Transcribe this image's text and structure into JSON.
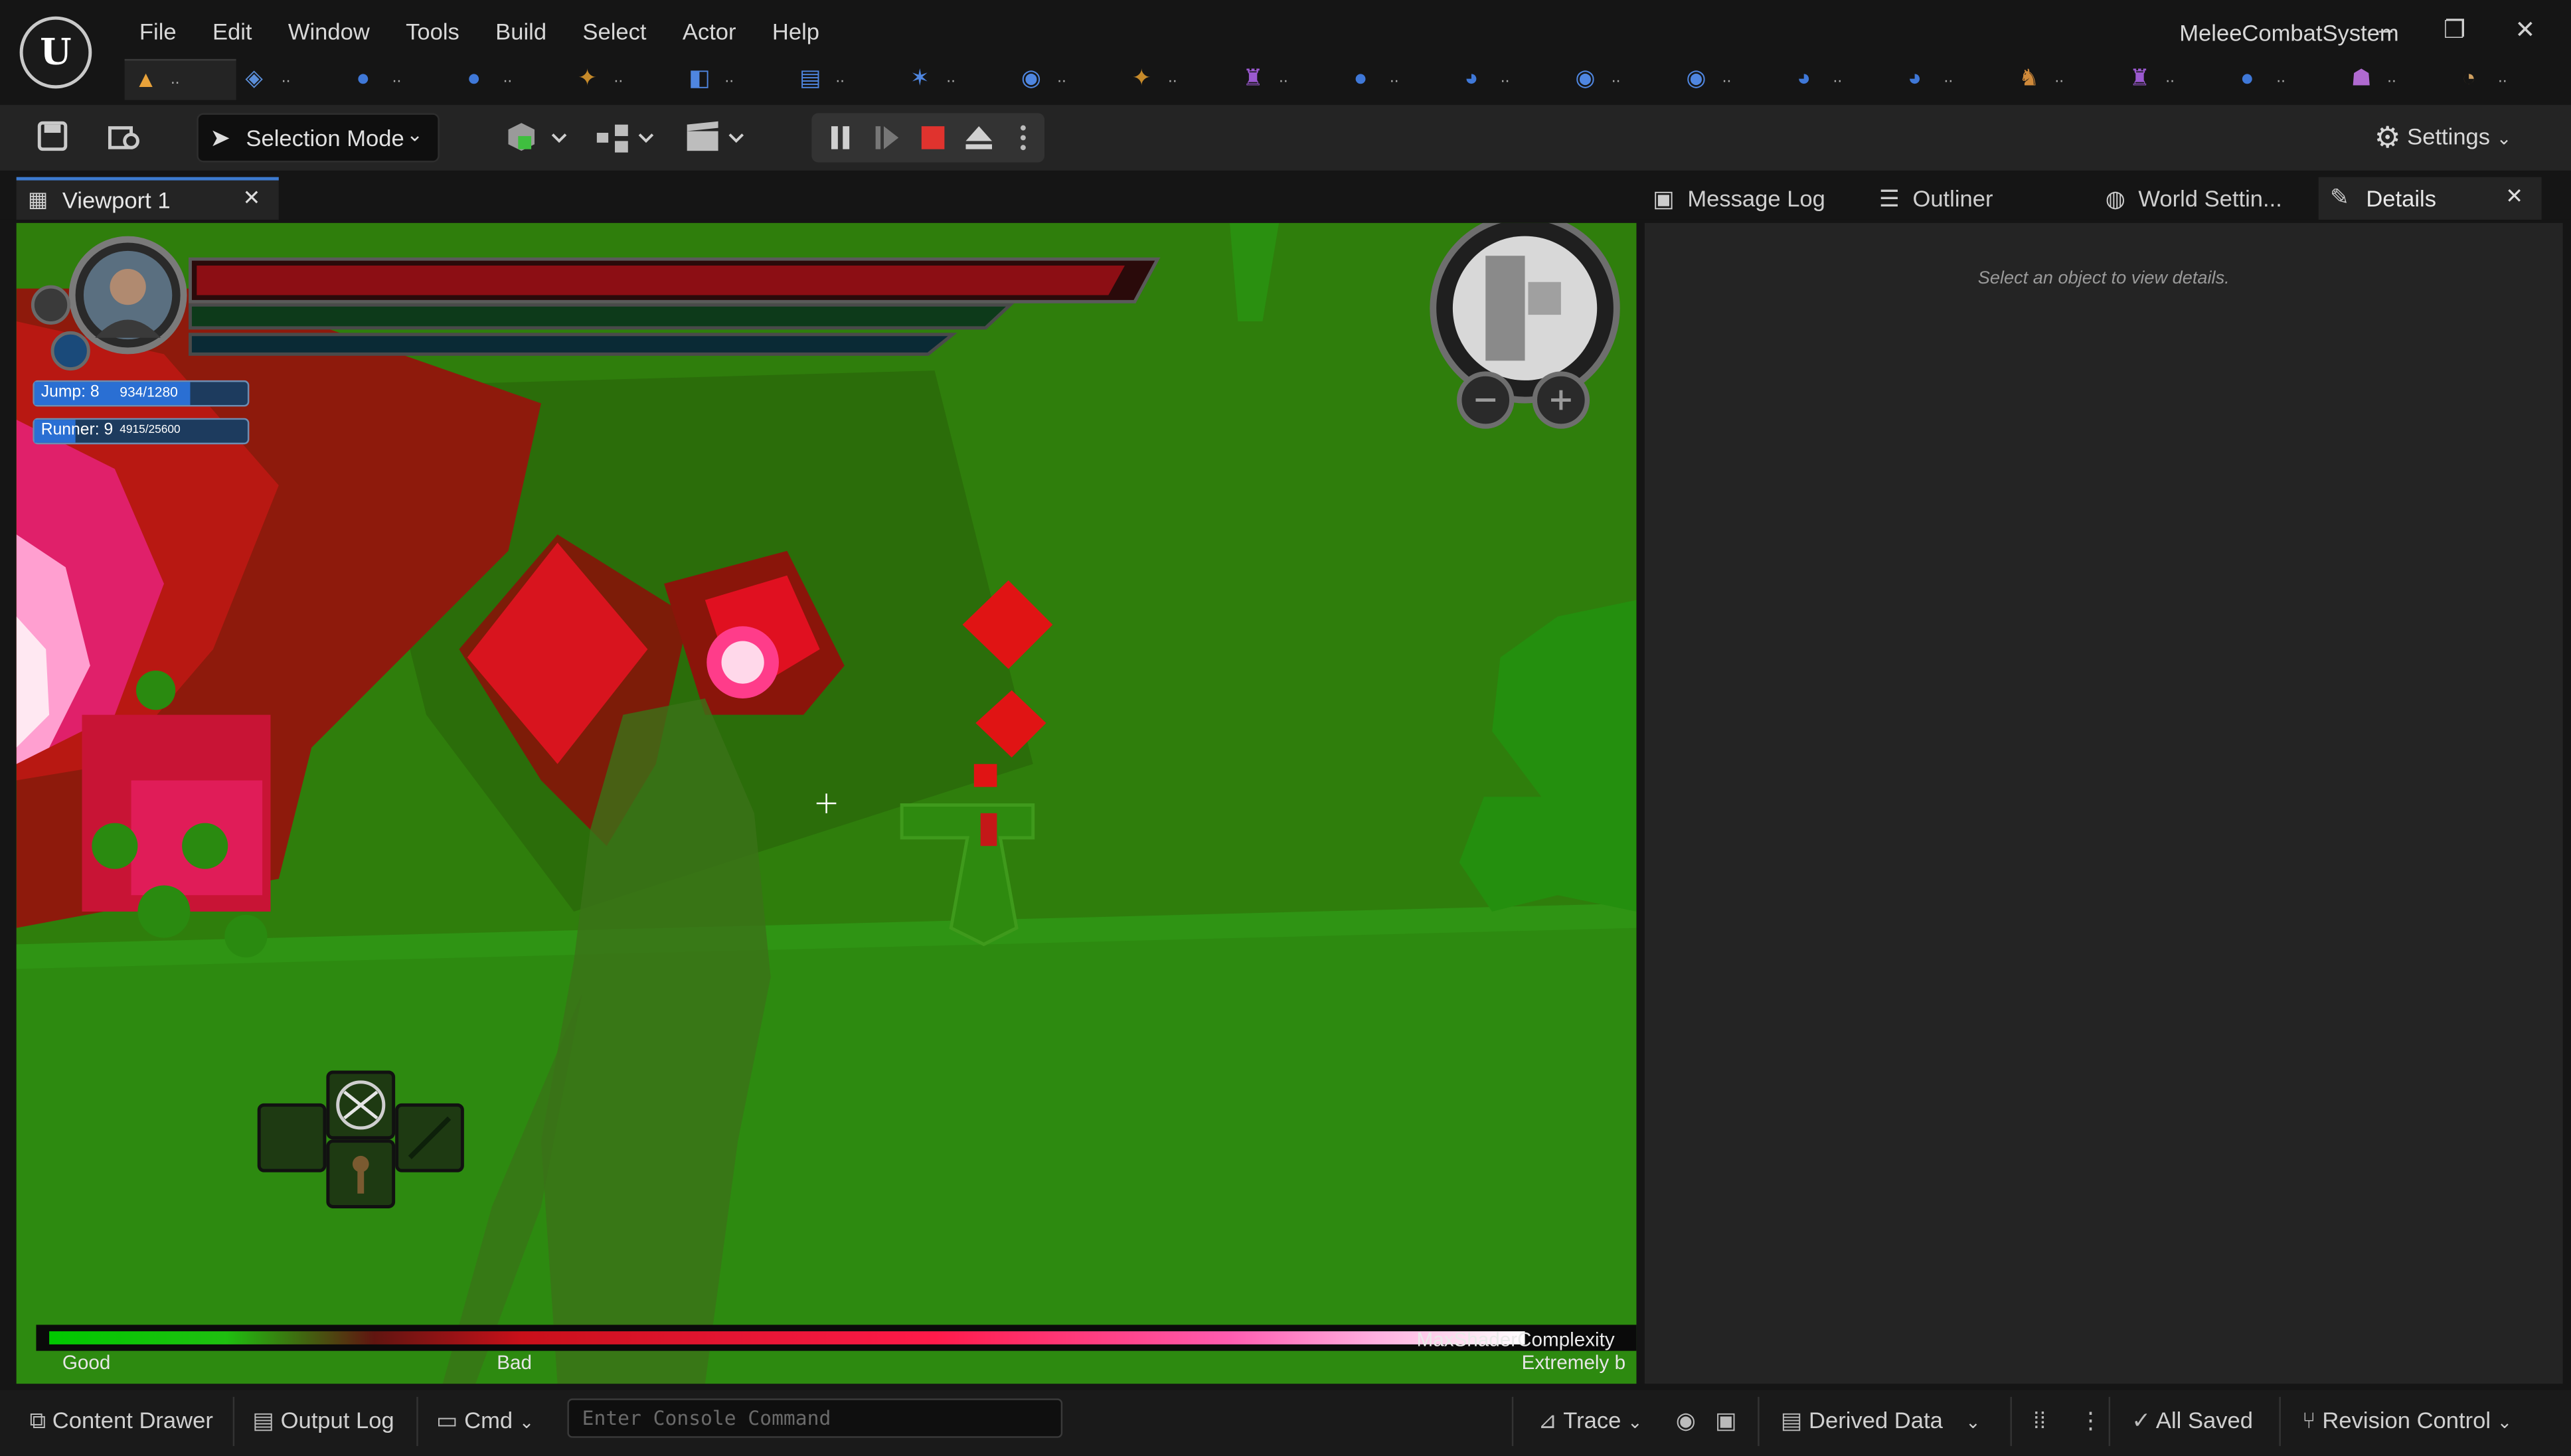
{
  "app": {
    "project_name": "MeleeCombatSystem",
    "logo_glyph": "U",
    "window_controls": {
      "minimize": "–",
      "restore": "❐",
      "close": "✕"
    }
  },
  "menu": [
    "File",
    "Edit",
    "Window",
    "Tools",
    "Build",
    "Select",
    "Actor",
    "Help"
  ],
  "asset_tabs": [
    {
      "icon": "level-icon",
      "glyph": "▲",
      "color": "#e8a23a",
      "label": ".."
    },
    {
      "icon": "blueprint-icon",
      "glyph": "◈",
      "color": "#5b8ed8",
      "label": ".."
    },
    {
      "icon": "skeleton-icon",
      "glyph": "●",
      "color": "#3f78d8",
      "label": ".."
    },
    {
      "icon": "skeleton-icon",
      "glyph": "●",
      "color": "#3f78d8",
      "label": ".."
    },
    {
      "icon": "animation-icon",
      "glyph": "✦",
      "color": "#c68a2a",
      "label": ".."
    },
    {
      "icon": "blueprint-class-icon",
      "glyph": "◧",
      "color": "#4f86e0",
      "label": ".."
    },
    {
      "icon": "blendspace-icon",
      "glyph": "▤",
      "color": "#4f86e0",
      "label": ".."
    },
    {
      "icon": "control-rig-icon",
      "glyph": "✶",
      "color": "#4f86e0",
      "label": ".."
    },
    {
      "icon": "physics-asset-icon",
      "glyph": "◉",
      "color": "#4f86e0",
      "label": ".."
    },
    {
      "icon": "animation-icon",
      "glyph": "✦",
      "color": "#c68a2a",
      "label": ".."
    },
    {
      "icon": "montage-icon",
      "glyph": "♜",
      "color": "#9b59d0",
      "label": ".."
    },
    {
      "icon": "skeleton-icon",
      "glyph": "●",
      "color": "#3f78d8",
      "label": ".."
    },
    {
      "icon": "mesh-icon",
      "glyph": "◕",
      "color": "#3f78d8",
      "label": ".."
    },
    {
      "icon": "physics-asset-icon",
      "glyph": "◉",
      "color": "#4f86e0",
      "label": ".."
    },
    {
      "icon": "physics-asset-icon",
      "glyph": "◉",
      "color": "#4f86e0",
      "label": ".."
    },
    {
      "icon": "mesh-icon",
      "glyph": "◕",
      "color": "#3f78d8",
      "label": ".."
    },
    {
      "icon": "mesh-icon",
      "glyph": "◕",
      "color": "#3f78d8",
      "label": ".."
    },
    {
      "icon": "character-icon",
      "glyph": "♞",
      "color": "#d08a3a",
      "label": ".."
    },
    {
      "icon": "montage-icon",
      "glyph": "♜",
      "color": "#9b59d0",
      "label": ".."
    },
    {
      "icon": "skeleton-icon",
      "glyph": "●",
      "color": "#3f78d8",
      "label": ".."
    },
    {
      "icon": "material-icon",
      "glyph": "☗",
      "color": "#b06ad0",
      "label": ".."
    },
    {
      "icon": "texture-icon",
      "glyph": "◔",
      "color": "#d0a060",
      "label": ".."
    }
  ],
  "toolbar": {
    "selection_mode_label": "Selection Mode",
    "settings_label": "Settings"
  },
  "panel_tabs": {
    "viewport": "Viewport 1",
    "message_log": "Message Log",
    "outliner": "Outliner",
    "world_settings": "World Settin...",
    "details": "Details"
  },
  "details": {
    "hint": "Select an object to view details."
  },
  "hud": {
    "jump_label": "Jump: 8",
    "jump_value": "934/1280",
    "jump_progress": 0.73,
    "runner_label": "Runner: 9",
    "runner_value": "4915/25600",
    "runner_progress": 0.19
  },
  "legend": {
    "good": "Good",
    "bad": "Bad",
    "max_label": "MaxShaderComplexity",
    "extreme_label": "Extremely b"
  },
  "statusbar": {
    "content_drawer": "Content Drawer",
    "output_log": "Output Log",
    "cmd": "Cmd",
    "console_placeholder": "Enter Console Command",
    "trace": "Trace",
    "derived_data": "Derived Data",
    "all_saved": "All Saved",
    "revision_control": "Revision Control"
  },
  "colors": {
    "accent": "#3d7bd0",
    "stop_red": "#e0332e",
    "viewport_green": "#2b7a0b"
  }
}
